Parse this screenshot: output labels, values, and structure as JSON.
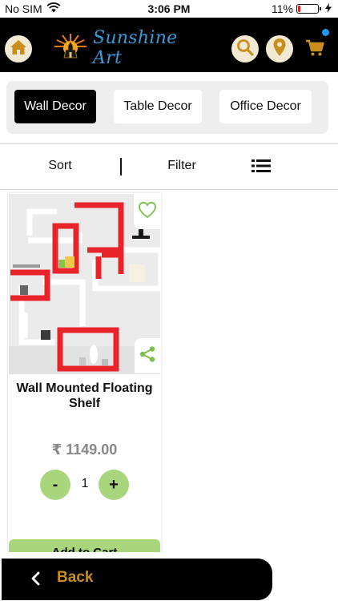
{
  "status_bar": {
    "carrier": "No SIM",
    "time": "3:06 PM",
    "battery": "11%",
    "battery_level": 0.11
  },
  "header": {
    "logo_text": "Sunshine Art",
    "icons": [
      "home-icon",
      "search-icon",
      "location-pin-icon",
      "cart-icon"
    ],
    "accent_color": "#c88e1e",
    "notification_color": "#2196f3"
  },
  "categories": {
    "tabs": [
      {
        "label": "Wall Decor",
        "active": true
      },
      {
        "label": "Table Decor",
        "active": false
      },
      {
        "label": "Office Decor",
        "active": false
      }
    ]
  },
  "toolbar": {
    "sort_label": "Sort",
    "filter_label": "Filter",
    "view_icon": "list-view-icon"
  },
  "products": [
    {
      "name": "Wall Mounted Floating Shelf",
      "price": "₹ 1149.00",
      "quantity": "1",
      "minus_label": "-",
      "plus_label": "+",
      "add_to_cart_label": "Add to Cart",
      "wishlist_icon": "heart-icon",
      "share_icon": "share-icon"
    }
  ],
  "footer": {
    "back_label": "Back",
    "back_icon": "chevron-left-icon"
  }
}
